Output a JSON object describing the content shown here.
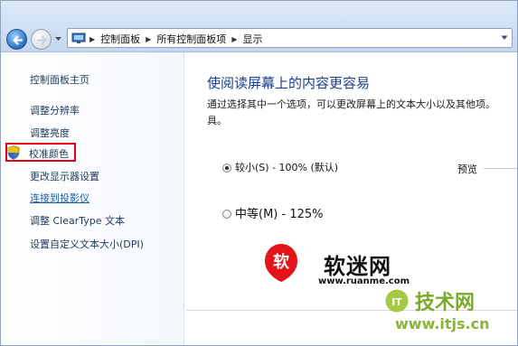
{
  "address_bar": {
    "crumbs": [
      "控制面板",
      "所有控制面板项",
      "显示"
    ]
  },
  "sidebar": {
    "home": "控制面板主页",
    "items": [
      {
        "label": "调整分辨率"
      },
      {
        "label": "调整亮度"
      },
      {
        "label": "校准颜色",
        "highlighted": true
      },
      {
        "label": "更改显示器设置"
      },
      {
        "label": "连接到投影仪"
      },
      {
        "label": "调整 ClearType 文本"
      },
      {
        "label": "设置自定义文本大小(DPI)"
      }
    ]
  },
  "main": {
    "title": "使阅读屏幕上的内容更容易",
    "description": "通过选择其中一个选项，可以更改屏幕上的文本大小以及其他项。具。",
    "options": [
      {
        "label": "较小(S) - 100% (默认)",
        "selected": true
      },
      {
        "label": "中等(M) - 125%",
        "selected": false
      }
    ],
    "preview_label": "预览"
  },
  "watermarks": {
    "brand1_text": "软迷网",
    "brand1_url": "www.ruanme.com",
    "brand1_badge": "软",
    "brand2_text": "技术网",
    "brand2_url": "www.itjs.cn",
    "brand2_logo": "IT"
  },
  "colors": {
    "accent_title": "#1a3e8f",
    "highlight_border": "#e2001a",
    "link": "#1f5ea8"
  },
  "icons": [
    "back-arrow-icon",
    "forward-arrow-icon",
    "control-panel-icon",
    "chevron-down-icon",
    "shield-icon"
  ]
}
